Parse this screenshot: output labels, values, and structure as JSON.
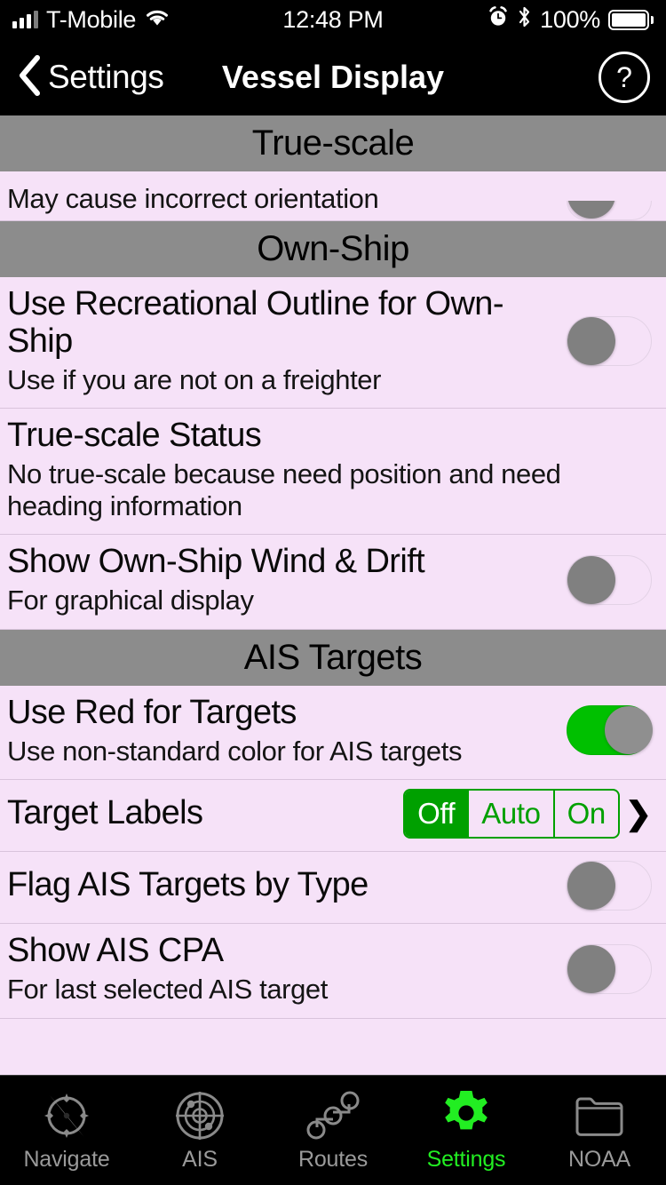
{
  "status_bar": {
    "carrier": "T-Mobile",
    "time": "12:48 PM",
    "battery_percent": "100%",
    "icons": [
      "signal-bars-icon",
      "wifi-icon",
      "alarm-icon",
      "bluetooth-icon",
      "battery-icon"
    ]
  },
  "nav_bar": {
    "back_label": "Settings",
    "title": "Vessel Display",
    "help_label": "?"
  },
  "sections": [
    {
      "header": "True-scale",
      "rows": [
        {
          "title": "",
          "subtitle": "May cause incorrect orientation",
          "control": "toggle",
          "toggle_on": false,
          "clipped": true
        }
      ]
    },
    {
      "header": "Own-Ship",
      "rows": [
        {
          "title": "Use Recreational Outline for Own-Ship",
          "subtitle": "Use if you are not on a freighter",
          "control": "toggle",
          "toggle_on": false
        },
        {
          "title": "True-scale Status",
          "subtitle": "No true-scale because need position and need heading information",
          "control": "none"
        },
        {
          "title": "Show Own-Ship Wind & Drift",
          "subtitle": "For graphical display",
          "control": "toggle",
          "toggle_on": false
        }
      ]
    },
    {
      "header": "AIS Targets",
      "rows": [
        {
          "title": "Use Red for Targets",
          "subtitle": "Use non-standard color for AIS targets",
          "control": "toggle",
          "toggle_on": true
        },
        {
          "title": "Target Labels",
          "subtitle": "",
          "control": "segmented",
          "options": [
            "Off",
            "Auto",
            "On"
          ],
          "selected": "Off",
          "chevron": "❯"
        },
        {
          "title": "Flag AIS Targets by Type",
          "subtitle": "",
          "control": "toggle",
          "toggle_on": false
        },
        {
          "title": "Show AIS CPA",
          "subtitle": "For last selected AIS target",
          "control": "toggle",
          "toggle_on": false
        }
      ]
    }
  ],
  "tab_bar": {
    "active": "Settings",
    "tabs": [
      {
        "label": "Navigate",
        "icon": "compass-icon"
      },
      {
        "label": "AIS",
        "icon": "radar-icon"
      },
      {
        "label": "Routes",
        "icon": "route-nodes-icon"
      },
      {
        "label": "Settings",
        "icon": "gear-icon"
      },
      {
        "label": "NOAA",
        "icon": "folder-icon"
      }
    ]
  },
  "colors": {
    "accent_green": "#00c000",
    "active_tab_green": "#22ee22",
    "row_background": "#f6e2f8",
    "section_header": "#8c8c8c",
    "bar_background": "#000000"
  }
}
